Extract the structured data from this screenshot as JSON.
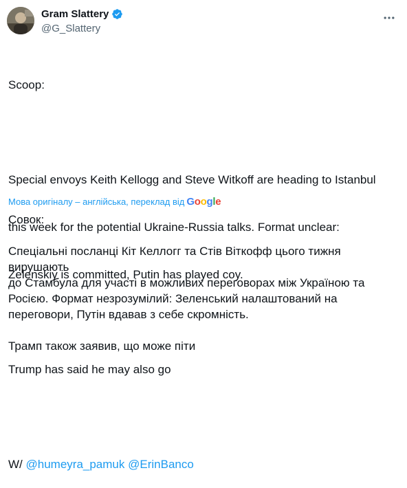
{
  "author": {
    "display_name": "Gram Slattery",
    "handle": "@G_Slattery"
  },
  "tweet": {
    "lines": [
      "Scoop:",
      "",
      "Special envoys Keith Kellogg and Steve Witkoff are heading to Istanbul",
      "this week for the potential Ukraine-Russia talks. Format unclear:",
      "Zelenskiy is committed, Putin has played coy.",
      "",
      "Trump has said he may also go",
      ""
    ],
    "credit_prefix": "W/ ",
    "mention_1": "@humeyra_pamuk",
    "mention_2": "@ErinBanco"
  },
  "translation_note": {
    "text": "Мова оригіналу – англійська, переклад від",
    "provider": "Google"
  },
  "translation": {
    "lines": [
      "Совок:",
      "",
      "Спеціальні посланці Кіт Келлогг та Стів Віткофф цього тижня вирушають",
      "до Стамбула для участі в можливих переговорах між Україною та",
      "Росією. Формат незрозумілий: Зеленський налаштований на",
      "переговори, Путін вдавав з себе скромність.",
      "",
      "Трамп також заявив, що може піти"
    ]
  },
  "colors": {
    "link": "#1d9bf0",
    "verified": "#1d9bf0",
    "secondary_text": "#536471"
  },
  "icons": [
    "verified-badge-icon",
    "more-options-icon"
  ]
}
